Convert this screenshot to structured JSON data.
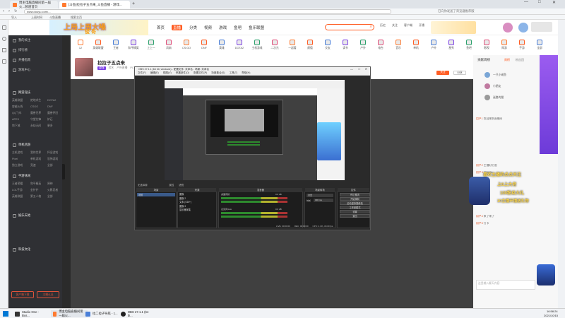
{
  "browser": {
    "tabs": [
      {
        "label": "博主电脑直播间第一届火...频道首页"
      },
      {
        "label": "[斗鱼]拉拉子五点来_斗鱼直播 - 游戏..."
      }
    ],
    "address": "www.douyu.com/...",
    "bookmarks": [
      "导入",
      "上班时间",
      "斗鱼直播",
      "搜索主页"
    ],
    "right_info": "已向你发送了浏览器推荐版"
  },
  "site": {
    "banner_text": "上局上周大嗓",
    "banner_sub": "俊 哥",
    "nav": [
      "首页",
      "直播",
      "分类",
      "视频",
      "游戏",
      "鱼吧",
      "鱼乐联盟"
    ],
    "search_placeholder": "",
    "header_right": [
      "历史",
      "关注",
      "客户端",
      "开播",
      "消息"
    ],
    "promo": "PC版斗鱼",
    "categories": [
      "12",
      "英雄联盟",
      "王者",
      "和平精英",
      "上上一",
      "风扇",
      "CS:GO",
      "DNF",
      "英雄",
      "DOTA2",
      "主机游戏",
      "二次元",
      "一起看",
      "颜值",
      "交友",
      "读书",
      "户外",
      "电台",
      "音乐",
      "单机",
      "户外",
      "星秀",
      "鱼吧",
      "影视",
      "网游",
      "手游",
      "全部"
    ],
    "category_badge": "1月1日"
  },
  "left_nav": {
    "items": [
      "我的关注",
      "排行榜",
      "开播指南",
      "游戏中心",
      "网游竞技",
      "单机热游",
      "手游休闲",
      "娱乐天地",
      "科技文化"
    ],
    "sub1": [
      "英雄联盟",
      "绝地求生",
      "DOTA2",
      "穿越火线",
      "CSGO",
      "DNF",
      "QQ飞车",
      "魔兽世界",
      "魔兽怀旧",
      "APEX",
      "守望先锋",
      "炉石",
      "地下城",
      "永劫无间",
      "更多"
    ],
    "sub2": [
      "主机游戏",
      "我的世界",
      "怀旧游戏",
      "Pixel",
      "单机游戏",
      "恐怖游戏",
      "独立游戏",
      "竞速",
      "全部"
    ],
    "sub3": [
      "王者荣耀",
      "和平精英",
      "原神",
      "LOL手游",
      "金铲铲",
      "火影忍者",
      "英雄联盟",
      "第五人格",
      "全部"
    ],
    "bottom_buttons": [
      "客户端下载",
      "主播认证"
    ]
  },
  "stream": {
    "title": "拉拉子五点来",
    "tags": [
      "游戏",
      "综艺",
      "户外直播",
      "PC"
    ],
    "follow": "关注",
    "share": "分享"
  },
  "obs": {
    "title": "OBS 27.1.1 (64 bit, windows) - 配置文件: 未命名 - 场景: 未命名",
    "menu": [
      "文件(F)",
      "编辑(E)",
      "视图(V)",
      "停靠部件(D)",
      "配置文件(P)",
      "场景集合(S)",
      "工具(T)",
      "帮助(H)"
    ],
    "toolbar_left": "无选择源",
    "toolbar_items": [
      "属性",
      "滤镜"
    ],
    "docks": {
      "scenes": "场景",
      "sources": "来源",
      "mixer": "混音器",
      "transitions": "场景转场",
      "controls": "控件"
    },
    "scene_item": "场景",
    "sources": [
      "图像",
      "图像 2",
      "文本 (GDI+)",
      "图像 3",
      "显示器采集"
    ],
    "mixer_channels": [
      {
        "name": "桌面音频",
        "db": "0.0 dB"
      },
      {
        "name": "麦克风/Aux",
        "db": "0.0 dB"
      }
    ],
    "transition": "淡出",
    "duration_label": "时长",
    "duration": "300 ms",
    "controls": [
      "停止推流",
      "开始录制",
      "启动虚拟摄像机",
      "工作室模式",
      "设置",
      "退出"
    ],
    "status": [
      "LIVE: 00:00:00",
      "REC: 00:00:00",
      "CPU: 2.4%, 30.00 fps"
    ]
  },
  "chat": {
    "rank_title": "贡献周榜",
    "rank_tabs": [
      "周榜",
      "粉丝团"
    ],
    "ranks": [
      "一只小咸鱼",
      "小朋友",
      "迷路的猫"
    ],
    "announcement": "欢迎来到直播间",
    "lines": [
      {
        "user": "用户1",
        "text": "欢迎来到直播间"
      },
      {
        "user": "用户2",
        "text": "主播好厉害"
      },
      {
        "user": "用户3",
        "text": "666666"
      },
      {
        "user": "用户4",
        "text": "来了来了"
      },
      {
        "user": "用户5",
        "text": "打卡"
      }
    ],
    "overlay_lines": [
      "喜欢主播的点点关注",
      "上6上大老",
      "100粉丝大礼",
      "10主播开播送礼物"
    ],
    "input_placeholder": "这里输入聊天内容"
  },
  "taskbar": {
    "apps": [
      "Studio One - Bus...",
      "博主电脑直播间第一届火...",
      "拉二拉子导航 - 1...",
      "OBS 27.1.1 (64 bi..."
    ],
    "time": "16:58:24",
    "date": "2021/10/15"
  },
  "colors": {
    "accent": "#ff5d23",
    "brand_purple": "#7b3fe4",
    "obs_bg": "#2a2a2a"
  }
}
